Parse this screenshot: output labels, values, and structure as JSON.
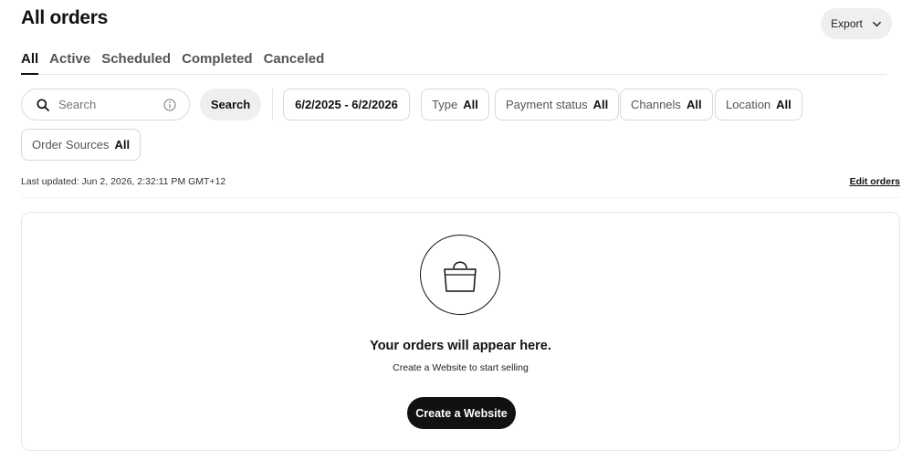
{
  "header": {
    "title": "All orders",
    "export_label": "Export",
    "export_icon": "chevron-down-icon"
  },
  "tabs": [
    {
      "label": "All",
      "active": true
    },
    {
      "label": "Active",
      "active": false
    },
    {
      "label": "Scheduled",
      "active": false
    },
    {
      "label": "Completed",
      "active": false
    },
    {
      "label": "Canceled",
      "active": false
    }
  ],
  "search": {
    "placeholder": "Search",
    "value": "",
    "button_label": "Search",
    "icon": "search-icon",
    "info_icon": "info-icon"
  },
  "filters": {
    "date_range": "6/2/2025 - 6/2/2026",
    "type": {
      "label": "Type",
      "value": "All"
    },
    "payment_status": {
      "label": "Payment status",
      "value": "All"
    },
    "channels": {
      "label": "Channels",
      "value": "All"
    },
    "location": {
      "label": "Location",
      "value": "All"
    },
    "order_sources": {
      "label": "Order Sources",
      "value": "All"
    }
  },
  "status": {
    "last_updated": "Last updated: Jun 2, 2026, 2:32:11 PM GMT+12",
    "edit_orders_label": "Edit orders"
  },
  "empty_state": {
    "icon": "shopping-bag-icon",
    "title": "Your orders will appear here.",
    "subtitle": "Create a Website to start selling",
    "cta_label": "Create a Website"
  }
}
